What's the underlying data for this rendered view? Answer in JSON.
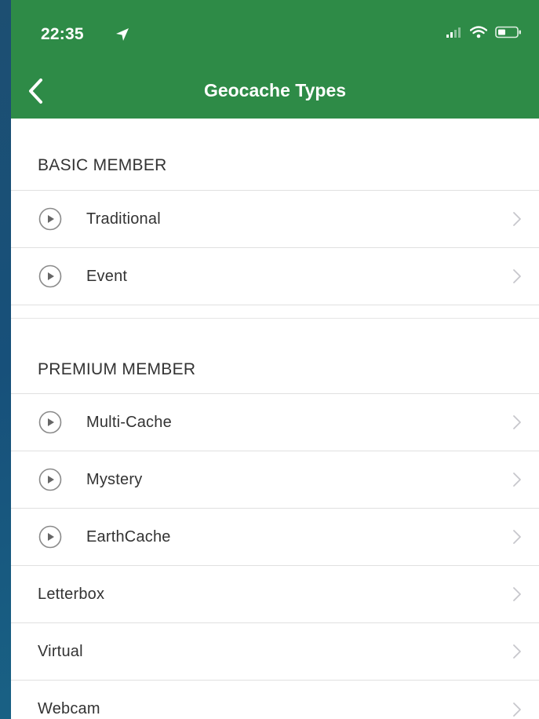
{
  "status_bar": {
    "time": "22:35",
    "location_icon": "location-arrow-icon",
    "signal_icon": "cellular-signal-icon",
    "wifi_icon": "wifi-icon",
    "battery_icon": "battery-icon"
  },
  "nav": {
    "title": "Geocache Types",
    "back_icon": "chevron-left-icon"
  },
  "sections": [
    {
      "header": "BASIC MEMBER",
      "items": [
        {
          "label": "Traditional",
          "has_play_icon": true
        },
        {
          "label": "Event",
          "has_play_icon": true
        }
      ]
    },
    {
      "header": "PREMIUM MEMBER",
      "items": [
        {
          "label": "Multi-Cache",
          "has_play_icon": true
        },
        {
          "label": "Mystery",
          "has_play_icon": true
        },
        {
          "label": "EarthCache",
          "has_play_icon": true
        },
        {
          "label": "Letterbox",
          "has_play_icon": false
        },
        {
          "label": "Virtual",
          "has_play_icon": false
        },
        {
          "label": "Webcam",
          "has_play_icon": false
        }
      ]
    }
  ],
  "colors": {
    "nav_background": "#2e8b47",
    "text": "#333333",
    "divider": "#e0e0e0",
    "chevron": "#c7c7cc",
    "icon_gray": "#8a8a8a"
  }
}
